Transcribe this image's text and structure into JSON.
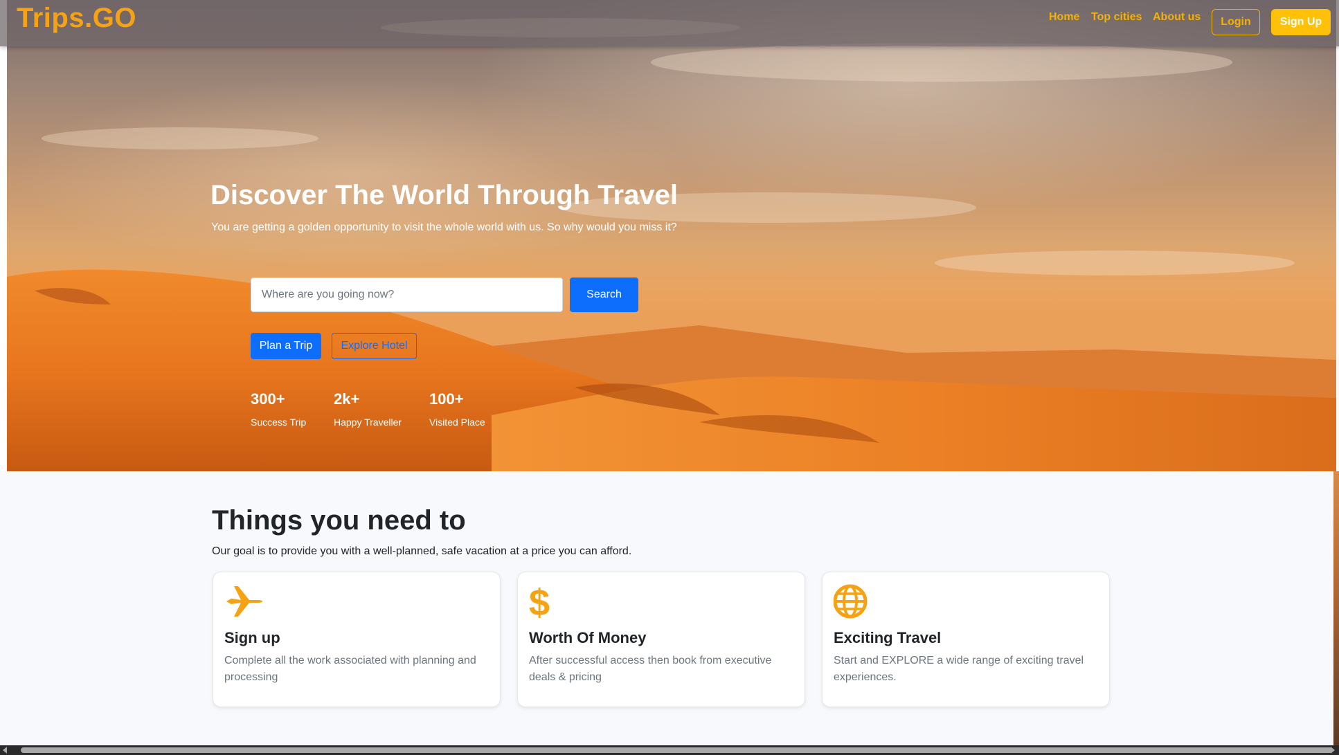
{
  "navbar": {
    "brand": "Trips.GO",
    "links": [
      "Home",
      "Top cities",
      "About us"
    ],
    "login_label": "Login",
    "signup_label": "Sign Up"
  },
  "hero": {
    "title": "Discover The World Through Travel",
    "subtitle": "You are getting a golden opportunity to visit the whole world with us. So why would you miss it?",
    "search": {
      "placeholder": "Where are you going now?",
      "value": "",
      "button_label": "Search"
    },
    "plan_label": "Plan a Trip",
    "explore_label": "Explore Hotel",
    "stats": [
      {
        "number": "300+",
        "label": "Success Trip"
      },
      {
        "number": "2k+",
        "label": "Happy Traveller"
      },
      {
        "number": "100+",
        "label": "Visited Place"
      }
    ]
  },
  "features": {
    "title": "Things you need to",
    "subtitle": "Our goal is to provide you with a well-planned, safe vacation at a price you can afford.",
    "cards": [
      {
        "icon": "airplane-icon",
        "title": "Sign up",
        "text": "Complete all the work associated with planning and processing"
      },
      {
        "icon": "dollar-icon",
        "title": "Worth Of Money",
        "text": "After successful access then book from executive deals & pricing"
      },
      {
        "icon": "globe-icon",
        "title": "Exciting Travel",
        "text": "Start and EXPLORE a wide range of exciting travel experiences."
      }
    ]
  },
  "colors": {
    "brand": "#f5a315",
    "nav_link": "#f5b300",
    "signup_bg": "#ffc107",
    "primary": "#0d6efd",
    "icon": "#f5a315"
  }
}
